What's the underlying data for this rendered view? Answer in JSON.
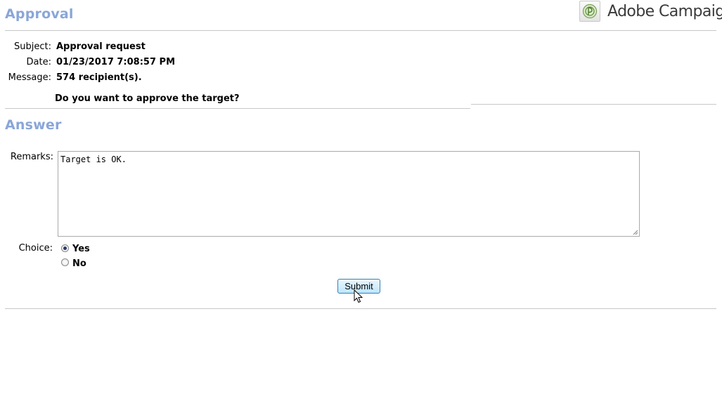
{
  "header": {
    "title": "Approval",
    "brand": "Adobe Campaign",
    "brand_icon": "adobe-campaign-logo-icon"
  },
  "details": {
    "subject_label": "Subject:",
    "subject_value": "Approval request",
    "date_label": "Date:",
    "date_value": "01/23/2017 7:08:57 PM",
    "message_label": "Message:",
    "message_value": "574 recipient(s).",
    "question": "Do you want to approve the target?"
  },
  "answer": {
    "title": "Answer",
    "remarks_label": "Remarks:",
    "remarks_value": "Target is OK.",
    "choice_label": "Choice:",
    "options": [
      {
        "label": "Yes",
        "selected": true
      },
      {
        "label": "No",
        "selected": false
      }
    ],
    "submit_label": "Submit"
  },
  "colors": {
    "section_title": "#8aa6d8",
    "button_border": "#3c7fb1",
    "divider": "#c8c8c8"
  }
}
